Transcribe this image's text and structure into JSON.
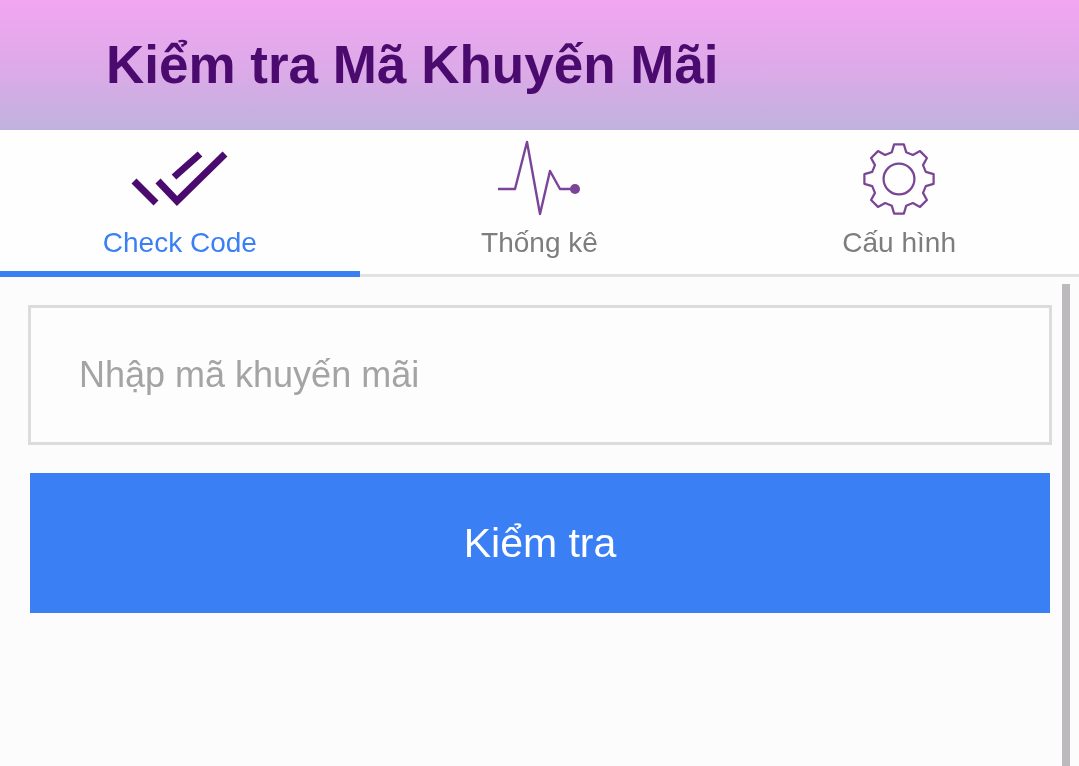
{
  "header": {
    "title": "Kiểm tra Mã Khuyến Mãi"
  },
  "tabs": [
    {
      "label": "Check Code",
      "selected": true
    },
    {
      "label": "Thống kê",
      "selected": false
    },
    {
      "label": "Cấu hình",
      "selected": false
    }
  ],
  "code_field": {
    "placeholder": "Nhập mã khuyến mãi"
  },
  "check_button": {
    "label": "Kiểm tra"
  }
}
